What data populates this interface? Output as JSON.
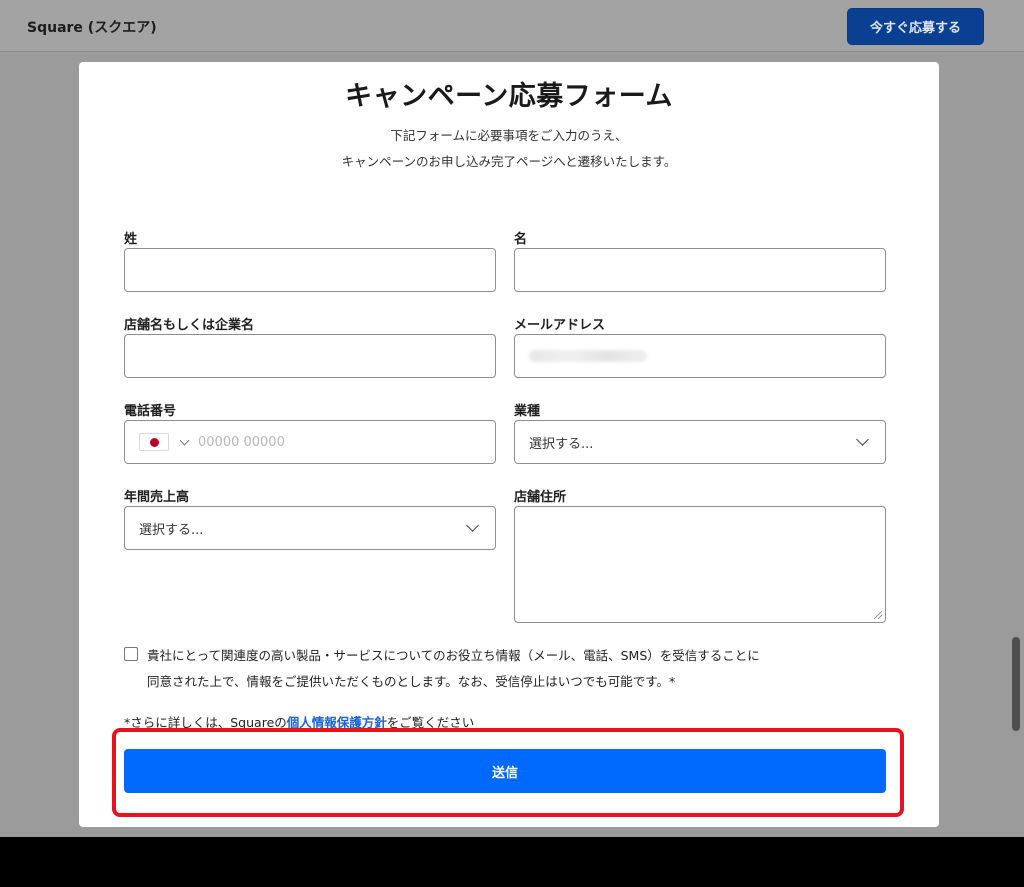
{
  "header": {
    "brand": "Square (スクエア)",
    "cta_label": "今すぐ応募する"
  },
  "form": {
    "title": "キャンペーン応募フォーム",
    "subtitle_line1": "下記フォームに必要事項をご入力のうえ、",
    "subtitle_line2": "キャンペーンのお申し込み完了ページへと遷移いたします。",
    "fields": {
      "last_name": {
        "label": "姓",
        "value": ""
      },
      "first_name": {
        "label": "名",
        "value": ""
      },
      "company": {
        "label": "店舗名もしくは企業名",
        "value": ""
      },
      "email": {
        "label": "メールアドレス"
      },
      "phone": {
        "label": "電話番号",
        "placeholder": "00000 00000",
        "country_icon": "japan-flag-icon"
      },
      "industry": {
        "label": "業種",
        "selected": "選択する..."
      },
      "annual_sales": {
        "label": "年間売上高",
        "selected": "選択する..."
      },
      "address": {
        "label": "店舗住所",
        "value": ""
      }
    },
    "consent_line1": "貴社にとって関連度の高い製品・サービスについてのお役立ち情報（メール、電話、SMS）を受信することに",
    "consent_line2": "同意された上で、情報をご提供いただくものとします。なお、受信停止はいつでも可能です。*",
    "privacy_prefix": "*さらに詳しくは、Squareの",
    "privacy_link": "個人情報保護方針",
    "privacy_suffix": "をご覧ください",
    "submit_label": "送信"
  },
  "colors": {
    "submit": "#006aff",
    "cta": "#0a3f91",
    "highlight": "#e8131d",
    "link": "#1a63d8"
  }
}
